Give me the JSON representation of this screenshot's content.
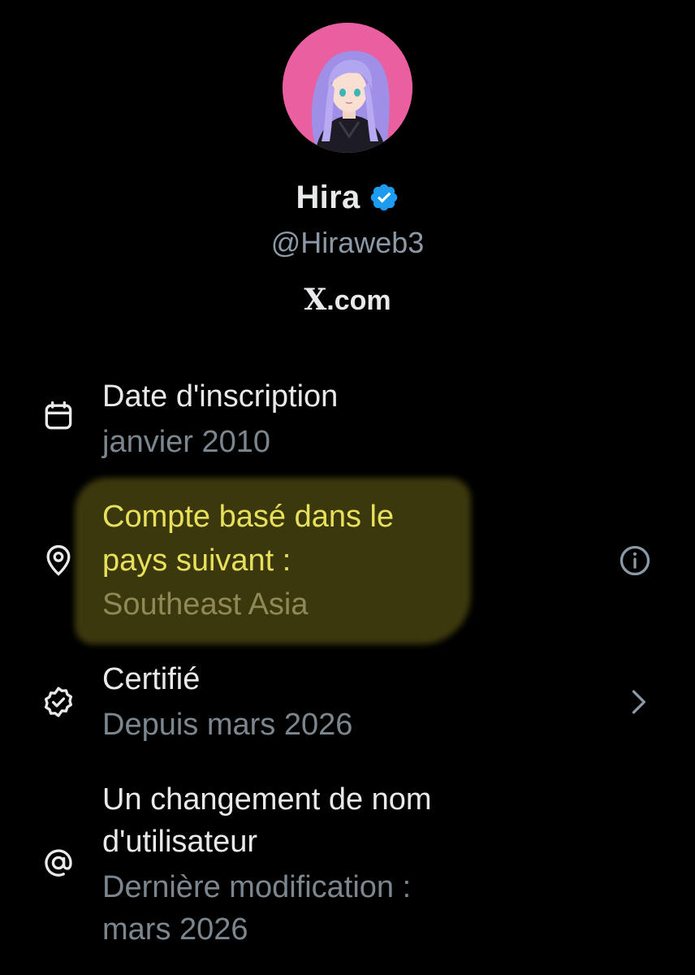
{
  "profile": {
    "display_name": "Hira",
    "verified": true,
    "handle": "@Hiraweb3",
    "site_glyph": "X",
    "site_suffix": ".com"
  },
  "rows": {
    "joined": {
      "title": "Date d'inscription",
      "value": "janvier 2010",
      "icon": "calendar-icon"
    },
    "country": {
      "title_line1": "Compte basé dans le",
      "title_line2": "pays suivant :",
      "value": "Southeast Asia",
      "icon": "location-pin-icon",
      "trailing_icon": "info-icon",
      "highlighted": true
    },
    "verified": {
      "title": "Certifié",
      "value": "Depuis mars 2026",
      "icon": "verified-badge-icon",
      "trailing_icon": "chevron-right-icon"
    },
    "username": {
      "title_line1": "Un changement de nom",
      "title_line2": "d'utilisateur",
      "value_line1": "Dernière modification :",
      "value_line2": "mars 2026",
      "icon": "at-sign-icon"
    }
  },
  "colors": {
    "background": "#000000",
    "primary_text": "#e7e9ea",
    "secondary_text": "#7c868f",
    "verified_blue": "#1d9bf0",
    "highlight_fill": "#3f3c0e",
    "highlight_text": "#e8e05a"
  }
}
